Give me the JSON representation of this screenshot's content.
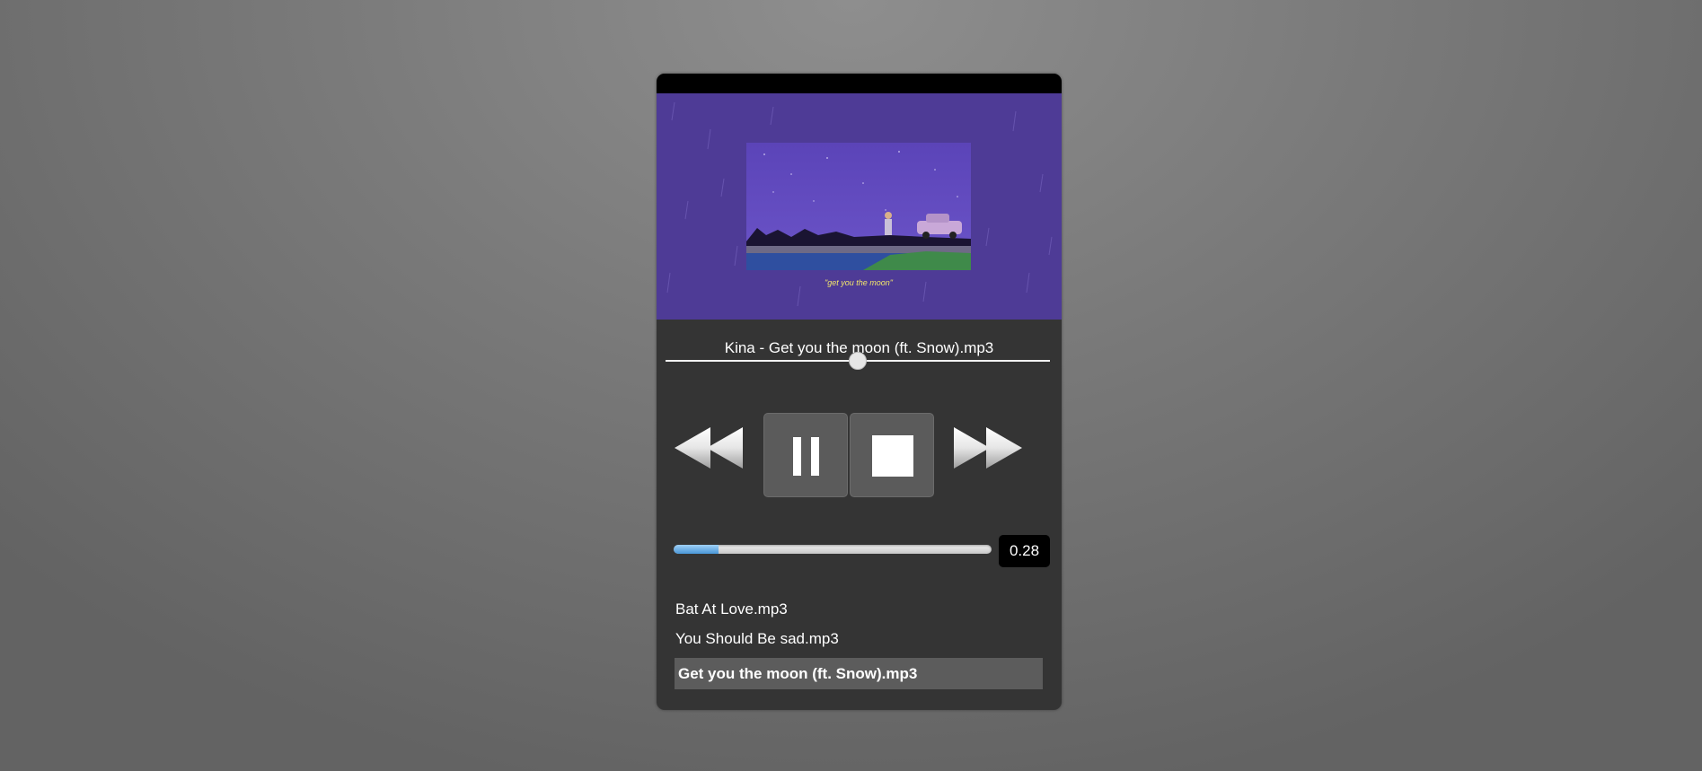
{
  "player": {
    "now_playing": "Kina - Get you the moon (ft. Snow).mp3",
    "artwork_caption": "\"get you the moon\"",
    "seek_progress": 0.5,
    "volume": {
      "value": 0.28,
      "display": "0.28"
    },
    "controls": {
      "previous": "previous-icon",
      "pause": "pause-icon",
      "stop": "stop-icon",
      "next": "next-icon"
    },
    "playlist": [
      "Bat At Love.mp3",
      "You Should Be sad.mp3",
      "Get you the moon (ft. Snow).mp3"
    ],
    "active_track_index": 2
  },
  "colors": {
    "panel": "#343434",
    "artwork_purple": "#4e3b96",
    "volume_fill": "#4a97d8"
  }
}
